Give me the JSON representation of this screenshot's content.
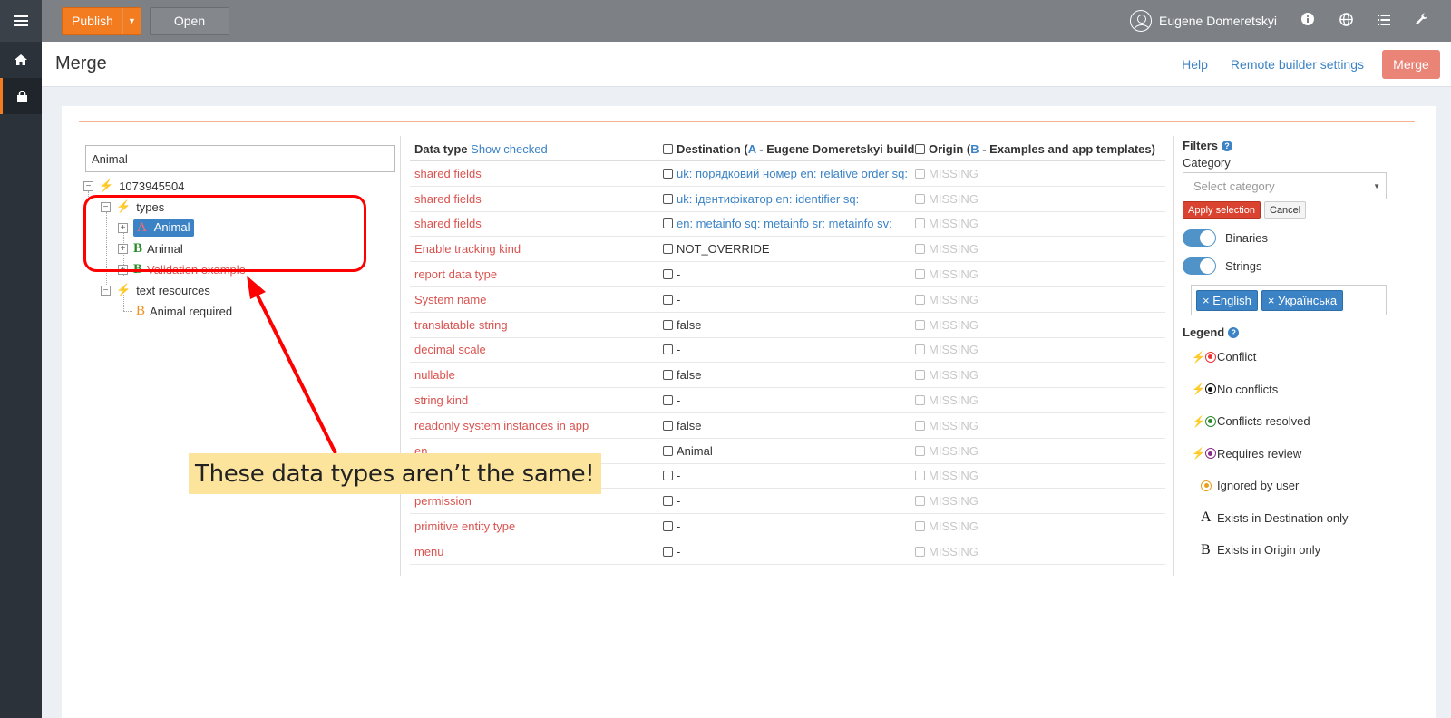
{
  "topbar": {
    "publish_label": "Publish",
    "open_label": "Open",
    "user_name": "Eugene Domeretskyi"
  },
  "sidebar": {
    "items": [
      {
        "icon": "menu-icon"
      },
      {
        "icon": "home-icon"
      },
      {
        "icon": "lock-icon"
      }
    ]
  },
  "header": {
    "title": "Merge",
    "help": "Help",
    "remote_builder": "Remote builder settings",
    "merge_button": "Merge"
  },
  "tree": {
    "search_value": "Animal",
    "root": "1073945504",
    "types": "types",
    "animal_a": "Animal",
    "animal_b": "Animal",
    "validation": "Validation example",
    "text_resources": "text resources",
    "animal_required": "Animal required"
  },
  "table": {
    "col_datatype": "Data type",
    "show_checked": "Show checked",
    "col_destination_prefix": "Destination (",
    "col_destination_letter": "A",
    "col_destination_rest": " - Eugene Domeretskyi build...",
    "col_origin_prefix": "Origin (",
    "col_origin_letter": "B",
    "col_origin_rest": " - Examples and app templates)",
    "rows": [
      {
        "name": "shared fields",
        "dest": "uk: порядковий номер en: relative order sq:",
        "origin": "MISSING"
      },
      {
        "name": "shared fields",
        "dest": "uk: ідентифікатор en: identifier sq:",
        "origin": "MISSING"
      },
      {
        "name": "shared fields",
        "dest": "en: metainfo sq: metainfo sr: metainfo sv:",
        "origin": "MISSING"
      },
      {
        "name": "Enable tracking kind",
        "dest": "NOT_OVERRIDE",
        "origin": "MISSING"
      },
      {
        "name": "report data type",
        "dest": "-",
        "origin": "MISSING"
      },
      {
        "name": "System name",
        "dest": "-",
        "origin": "MISSING"
      },
      {
        "name": "translatable string",
        "dest": "false",
        "origin": "MISSING"
      },
      {
        "name": "decimal scale",
        "dest": "-",
        "origin": "MISSING"
      },
      {
        "name": "nullable",
        "dest": "false",
        "origin": "MISSING"
      },
      {
        "name": "string kind",
        "dest": "-",
        "origin": "MISSING"
      },
      {
        "name": "readonly system instances in app",
        "dest": "false",
        "origin": "MISSING"
      },
      {
        "name": "en",
        "dest": "Animal",
        "origin": "MISSING"
      },
      {
        "name": "",
        "dest": "-",
        "origin": "MISSING"
      },
      {
        "name": "permission",
        "dest": "-",
        "origin": "MISSING"
      },
      {
        "name": "primitive entity type",
        "dest": "-",
        "origin": "MISSING"
      },
      {
        "name": "menu",
        "dest": "-",
        "origin": "MISSING"
      }
    ]
  },
  "filters": {
    "title": "Filters",
    "category_label": "Category",
    "category_placeholder": "Select category",
    "apply": "Apply selection",
    "cancel": "Cancel",
    "binaries": "Binaries",
    "strings": "Strings",
    "lang_tags": [
      "English",
      "Українська"
    ]
  },
  "legend": {
    "title": "Legend",
    "items": [
      {
        "label": "Conflict",
        "color": "#e33"
      },
      {
        "label": "No conflicts",
        "color": "#111"
      },
      {
        "label": "Conflicts resolved",
        "color": "#2a8a2a"
      },
      {
        "label": "Requires review",
        "color": "#8a2a8a"
      },
      {
        "label": "Ignored by user",
        "color": "#e8a020"
      },
      {
        "label": "Exists in Destination only",
        "glyph": "A"
      },
      {
        "label": "Exists in Origin only",
        "glyph": "B"
      }
    ]
  },
  "annotation": {
    "callout": "These data types aren’t the same!"
  },
  "colors": {
    "accent": "#f47c20",
    "link": "#3c83c6",
    "conflict": "#d9534f"
  }
}
